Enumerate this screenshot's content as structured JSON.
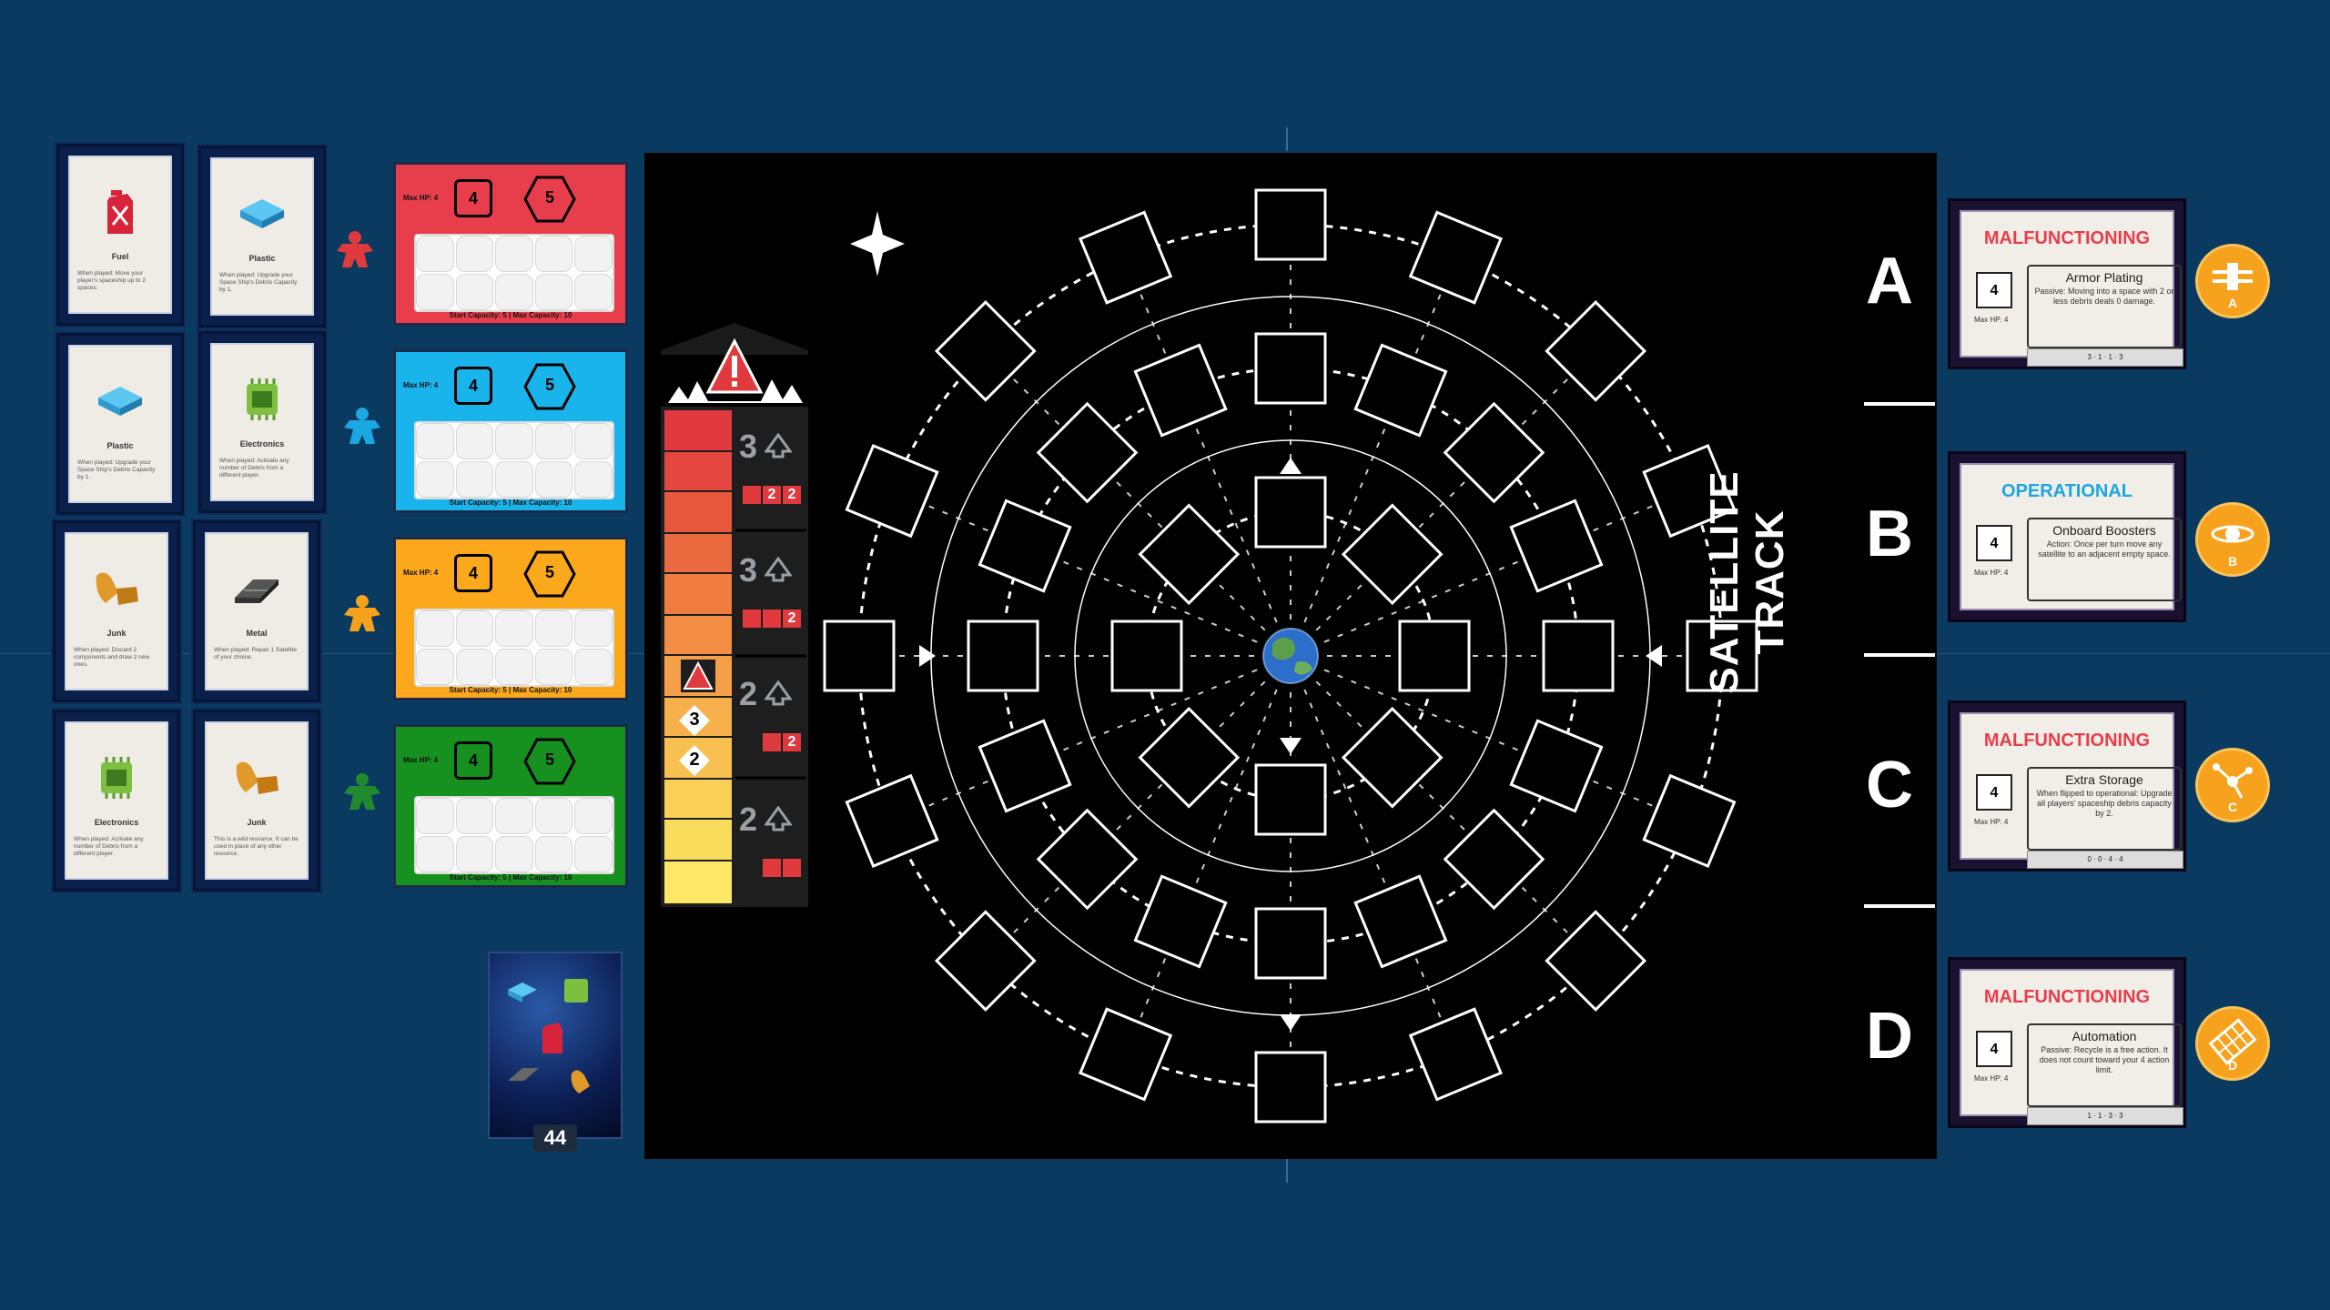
{
  "hand_cards": [
    {
      "name": "Fuel",
      "icon": "fuel-can-icon",
      "text": "When played: Move your player's spaceship up to 2 spaces."
    },
    {
      "name": "Plastic",
      "icon": "plastic-icon",
      "text": "When played: Upgrade your Space Ship's Debris Capacity by 1."
    },
    {
      "name": "Plastic",
      "icon": "plastic-icon",
      "text": "When played: Upgrade your Space Ship's Debris Capacity by 1."
    },
    {
      "name": "Electronics",
      "icon": "electronics-icon",
      "text": "When played: Activate any number of Debris from a different player."
    },
    {
      "name": "Junk",
      "icon": "junk-icon",
      "text": "When played: Discard 2 components and draw 2 new ones."
    },
    {
      "name": "Metal",
      "icon": "metal-icon",
      "text": "When played: Repair 1 Satellite of your choice."
    },
    {
      "name": "Electronics",
      "icon": "electronics-icon",
      "text": "When played: Activate any number of Debris from a different player."
    },
    {
      "name": "Junk",
      "icon": "junk-icon",
      "text": "This is a wild resource. It can be used in place of any other resource."
    }
  ],
  "meeple_colors": [
    "#e03a3e",
    "#1ba7e1",
    "#f6a21c",
    "#1f8a2e"
  ],
  "player_boards": [
    {
      "color": "#e83e4c",
      "max_hp": "Max HP: 4",
      "hp": "4",
      "hex": "5",
      "capacity": "Start Capacity: 5 | Max Capacity: 10"
    },
    {
      "color": "#1ab4ec",
      "max_hp": "Max HP: 4",
      "hp": "4",
      "hex": "5",
      "capacity": "Start Capacity: 5 | Max Capacity: 10"
    },
    {
      "color": "#fba81c",
      "max_hp": "Max HP: 4",
      "hp": "4",
      "hex": "5",
      "capacity": "Start Capacity: 5 | Max Capacity: 10"
    },
    {
      "color": "#16901f",
      "max_hp": "Max HP: 4",
      "hp": "4",
      "hex": "5",
      "capacity": "Start Capacity: 5 | Max Capacity: 10"
    }
  ],
  "damage_track": {
    "rows": [
      {
        "num": "3",
        "reds": [
          "",
          "2",
          "2"
        ]
      },
      {
        "num": "3",
        "reds": [
          "",
          "",
          "2"
        ]
      },
      {
        "num": "2",
        "reds": [
          "",
          "2"
        ]
      },
      {
        "num": "2",
        "reds": [
          "",
          ""
        ]
      }
    ],
    "markers": [
      "3",
      "2"
    ]
  },
  "satellite_track": {
    "title": "SATELLITE TRACK",
    "letters": [
      "A",
      "B",
      "C",
      "D"
    ]
  },
  "satellite_cards": [
    {
      "status": "MALFUNCTIONING",
      "status_color": "#e83e4c",
      "hp": "4",
      "max_hp": "Max HP: 4",
      "name": "Armor Plating",
      "desc": "Passive: Moving into a space with 2 or less debris deals 0 damage.",
      "cost": "3 · 1 · 1 · 3",
      "token": "A"
    },
    {
      "status": "OPERATIONAL",
      "status_color": "#1ba7e1",
      "hp": "4",
      "max_hp": "Max HP: 4",
      "name": "Onboard Boosters",
      "desc": "Action: Once per turn move any satellite to an adjacent empty space.",
      "cost": "",
      "token": "B"
    },
    {
      "status": "MALFUNCTIONING",
      "status_color": "#e83e4c",
      "hp": "4",
      "max_hp": "Max HP: 4",
      "name": "Extra Storage",
      "desc": "When flipped to operational: Upgrade all players' spaceship debris capacity by 2.",
      "cost": "0 · 0 · 4 · 4",
      "token": "C"
    },
    {
      "status": "MALFUNCTIONING",
      "status_color": "#e83e4c",
      "hp": "4",
      "max_hp": "Max HP: 4",
      "name": "Automation",
      "desc": "Passive: Recycle is a free action. It does not count toward your 4 action limit.",
      "cost": "1 · 1 · 3 · 3",
      "token": "D"
    }
  ],
  "deck": {
    "count": "44"
  }
}
